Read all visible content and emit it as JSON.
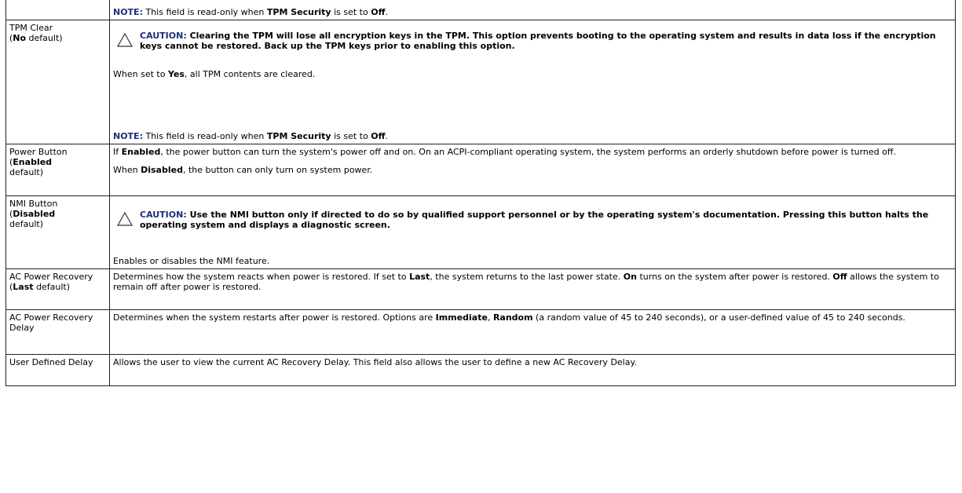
{
  "rows": [
    {
      "name": "",
      "default_value": "",
      "default_suffix": "",
      "note_label": "NOTE:",
      "note_text_1": " This field is read-only when ",
      "note_bold_1": "TPM Security",
      "note_text_2": " is set to ",
      "note_bold_2": "Off",
      "note_text_3": "."
    },
    {
      "name": "TPM Clear",
      "default_open": "(",
      "default_value": "No",
      "default_suffix": " default)",
      "caution_label": "CAUTION:",
      "caution_text": " Clearing the TPM will lose all encryption keys in the TPM. This option prevents booting to the operating system and results in data loss if the encryption keys cannot be restored. Back up the TPM keys prior to enabling this option.",
      "p1_a": "When set to ",
      "p1_b": "Yes",
      "p1_c": ", all TPM contents are cleared.",
      "note_label": "NOTE:",
      "note_text_1": " This field is read-only when ",
      "note_bold_1": "TPM Security",
      "note_text_2": " is set to ",
      "note_bold_2": "Off",
      "note_text_3": "."
    },
    {
      "name": "Power Button",
      "default_open": "(",
      "default_value": "Enabled",
      "default_suffix": "default)",
      "p1_a": "If ",
      "p1_b": "Enabled",
      "p1_c": ", the power button can turn the system's power off and on. On an ACPI-compliant operating system, the system performs an orderly shutdown before power is turned off.",
      "p2_a": "When ",
      "p2_b": "Disabled",
      "p2_c": ", the button can only turn on system power."
    },
    {
      "name": "NMI Button",
      "default_open": "(",
      "default_value": "Disabled",
      "default_suffix": "default)",
      "caution_label": "CAUTION:",
      "caution_text": " Use the NMI button only if directed to do so by qualified support personnel or by the operating system's documentation. Pressing this button halts the operating system and displays a diagnostic screen.",
      "p1": "Enables or disables the NMI feature."
    },
    {
      "name": "AC Power Recovery",
      "default_open": "(",
      "default_value": "Last",
      "default_suffix": " default)",
      "t1": "Determines how the system reacts when power is restored. If set to ",
      "b1": "Last",
      "t2": ", the system returns to the last power state. ",
      "b2": "On",
      "t3": " turns on the system after power is restored. ",
      "b3": "Off",
      "t4": " allows the system to remain off after power is restored."
    },
    {
      "name": "AC Power Recovery Delay",
      "t1": "Determines when the system restarts after power is restored. Options are ",
      "b1": "Immediate",
      "t2": ", ",
      "b2": "Random",
      "t3": " (a random value of 45 to 240 seconds), or a user-defined value of 45 to 240 seconds."
    },
    {
      "name": "User Defined Delay",
      "t1": "Allows the user to view the current AC Recovery Delay. This field also allows the user to define a new AC Recovery Delay."
    }
  ]
}
